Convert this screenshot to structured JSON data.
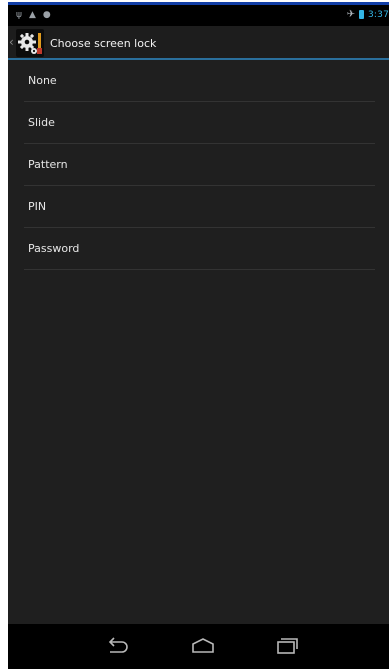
{
  "status_bar": {
    "time": "3:37"
  },
  "action_bar": {
    "title": "Choose screen lock",
    "icon": "settings-gear-icon"
  },
  "options": [
    {
      "label": "None"
    },
    {
      "label": "Slide"
    },
    {
      "label": "Pattern"
    },
    {
      "label": "PIN"
    },
    {
      "label": "Password"
    }
  ],
  "nav_bar": {
    "back_icon": "back-icon",
    "home_icon": "home-icon",
    "recents_icon": "recent-apps-icon"
  },
  "colors": {
    "accent": "#33b5e5",
    "background": "#1f1f1f"
  }
}
